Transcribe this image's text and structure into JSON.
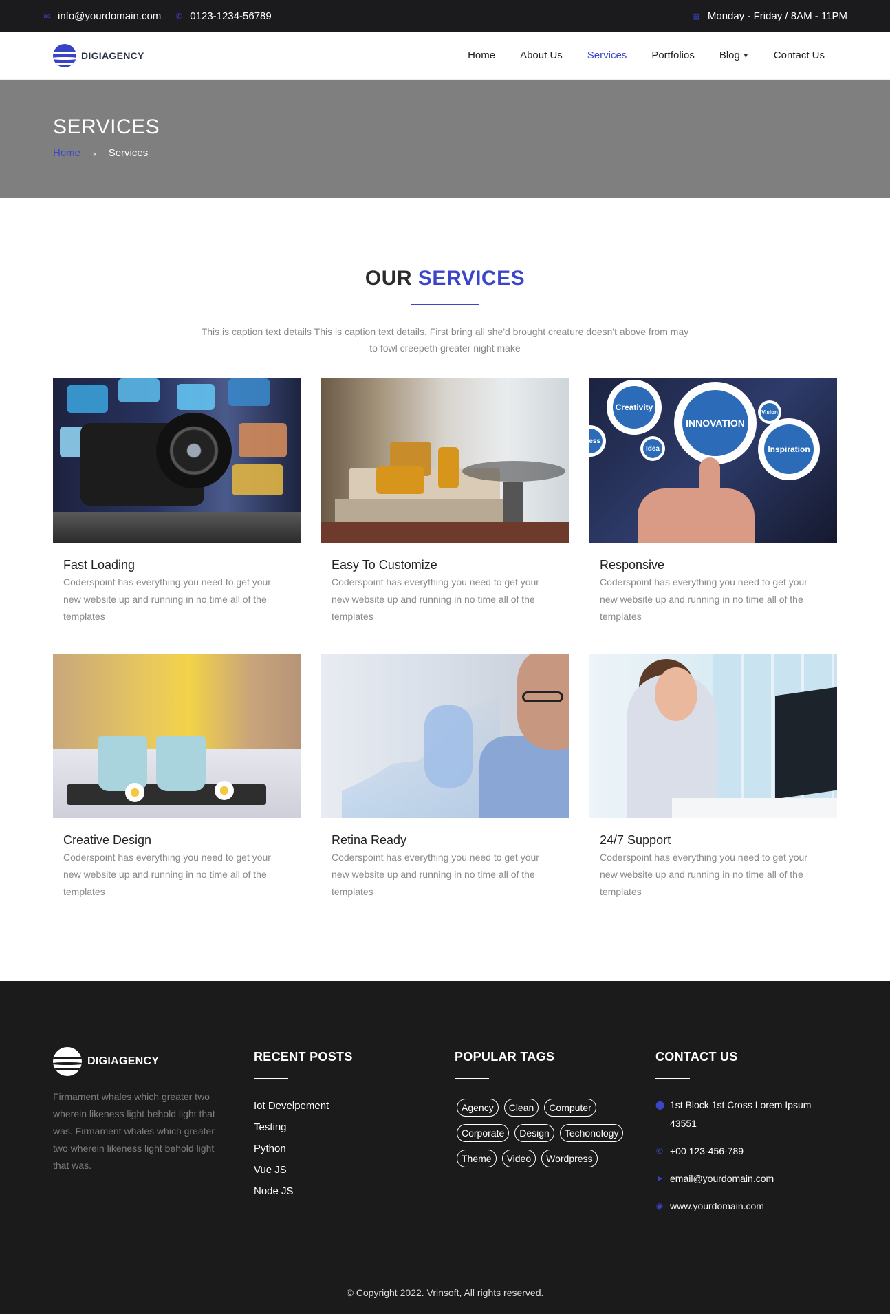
{
  "topbar": {
    "email": "info@yourdomain.com",
    "phone": "0123-1234-56789",
    "hours": "Monday - Friday / 8AM - 11PM",
    "email_icon": "envelope-icon",
    "phone_icon": "phone-icon",
    "hours_icon": "calendar-icon"
  },
  "brand": {
    "name": "DIGIAGENCY"
  },
  "nav": {
    "items": [
      {
        "label": "Home"
      },
      {
        "label": "About Us"
      },
      {
        "label": "Services",
        "active": true
      },
      {
        "label": "Portfolios"
      },
      {
        "label": "Blog"
      },
      {
        "label": "Contact Us"
      }
    ]
  },
  "page_header": {
    "title": "SERVICES",
    "breadcrumb_home": "Home",
    "breadcrumb_sep": "›",
    "breadcrumb_current": "Services"
  },
  "services_section": {
    "title_part1": "OUR",
    "title_part2": "SERVICES",
    "caption": "This is caption text details This is caption text details. First bring all she'd brought creature doesn't above from may to fowl creepeth greater night make",
    "cards": [
      {
        "title": "Fast Loading",
        "text": "Coderspoint has everything you need to get your new website up and running in no time all of the templates"
      },
      {
        "title": "Easy To Customize",
        "text": "Coderspoint has everything you need to get your new website up and running in no time all of the templates"
      },
      {
        "title": "Responsive",
        "text": "Coderspoint has everything you need to get your new website up and running in no time all of the templates"
      },
      {
        "title": "Creative Design",
        "text": "Coderspoint has everything you need to get your new website up and running in no time all of the templates"
      },
      {
        "title": "Retina Ready",
        "text": "Coderspoint has everything you need to get your new website up and running in no time all of the templates"
      },
      {
        "title": "24/7 Support",
        "text": "Coderspoint has everything you need to get your new website up and running in no time all of the templates"
      }
    ],
    "gear_labels": [
      "Creativity",
      "INNOVATION",
      "Inspiration",
      "Idea",
      "Vision",
      "ess"
    ]
  },
  "footer": {
    "brand": "DIGIAGENCY",
    "about": "Firmament whales which greater two wherein likeness light behold light that was. Firmament whales which greater two wherein likeness light behold light that was.",
    "recent_posts_title": "RECENT POSTS",
    "recent_posts": [
      "Iot Develpement",
      "Testing",
      "Python",
      "Vue JS",
      "Node JS"
    ],
    "tags_title": "POPULAR TAGS",
    "tags": [
      "Agency",
      "Clean",
      "Computer",
      "Corporate",
      "Design",
      "Techonology",
      "Theme",
      "Video",
      "Wordpress"
    ],
    "contact_title": "CONTACT US",
    "contact": {
      "address": "1st Block 1st Cross Lorem Ipsum 43551",
      "phone": "+00 123-456-789",
      "email": "email@yourdomain.com",
      "website": "www.yourdomain.com"
    },
    "copyright": "© Copyright 2022. Vrinsoft, All rights reserved."
  },
  "colors": {
    "accent": "#3a45c9",
    "dark": "#1b1b1b",
    "header_gray": "#7f7f7f"
  }
}
